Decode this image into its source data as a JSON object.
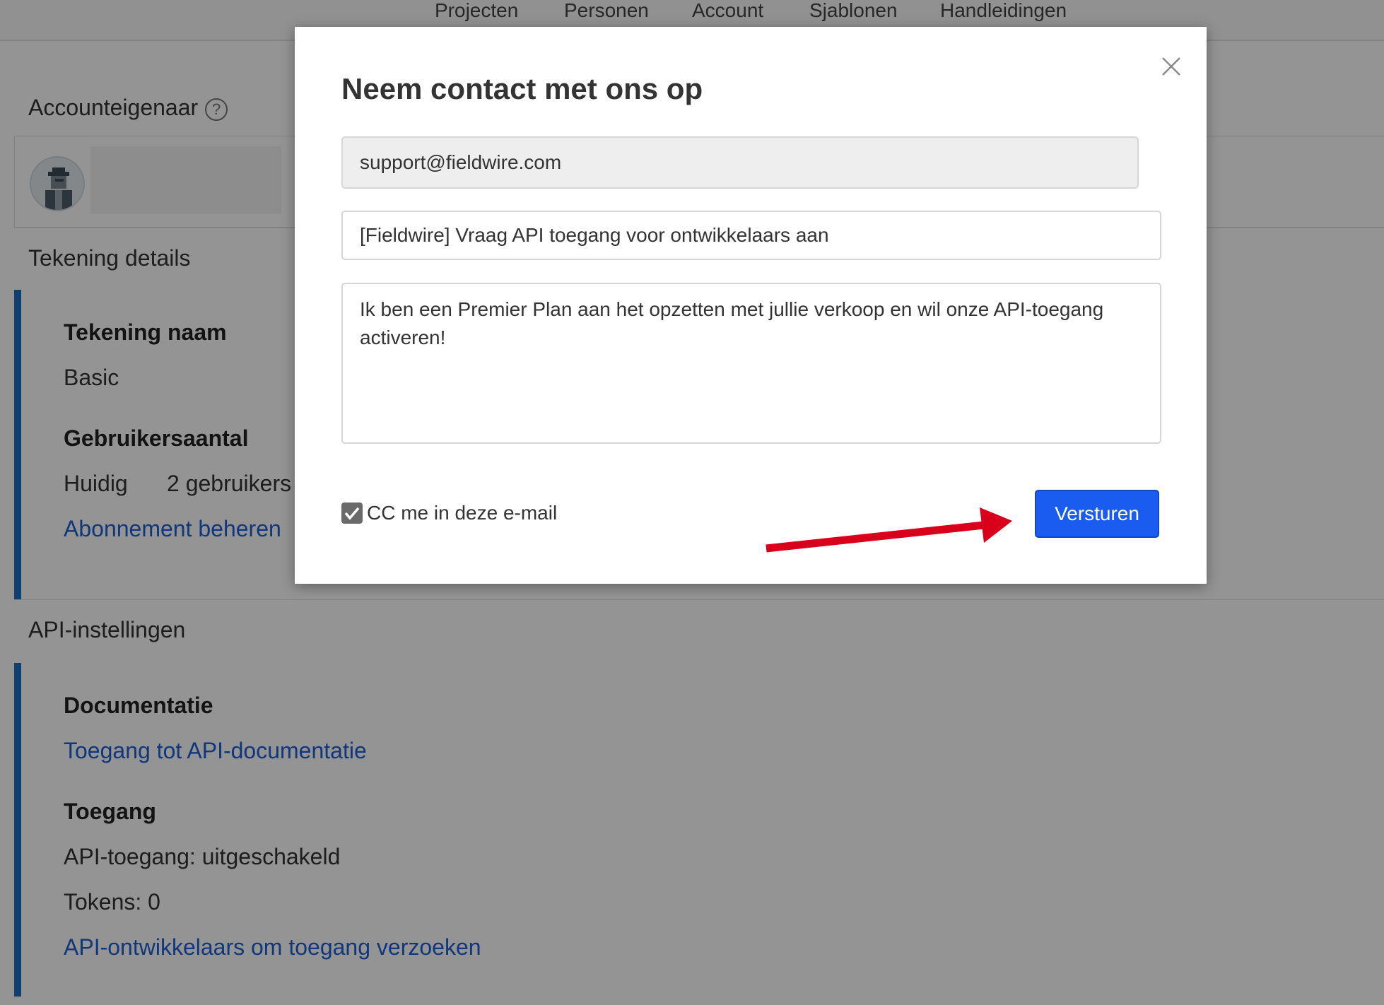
{
  "topnav": {
    "items": [
      "Projecten",
      "Personen",
      "Account",
      "Sjablonen",
      "Handleidingen"
    ]
  },
  "owner": {
    "heading": "Accounteigenaar",
    "help_glyph": "?"
  },
  "plan": {
    "heading": "Tekening details",
    "name_label": "Tekening naam",
    "name_value": "Basic",
    "users_label": "Gebruikersaantal",
    "current_label": "Huidig",
    "current_value": "2 gebruikers",
    "manage_link": "Abonnement beheren"
  },
  "api": {
    "heading": "API-instellingen",
    "docs_label": "Documentatie",
    "docs_link": "Toegang tot API-documentatie",
    "access_label": "Toegang",
    "access_status": "API-toegang: uitgeschakeld",
    "tokens": "Tokens: 0",
    "request_link": "API-ontwikkelaars om toegang verzoeken"
  },
  "modal": {
    "title": "Neem contact met ons op",
    "to": "support@fieldwire.com",
    "subject": "[Fieldwire] Vraag API toegang voor ontwikkelaars aan",
    "body": "Ik ben een Premier Plan aan het opzetten met jullie verkoop en wil onze API-toegang activeren!",
    "cc_label": "CC me in deze e-mail",
    "cc_checked": true,
    "send_label": "Versturen"
  },
  "colors": {
    "accent": "#1a5cf0",
    "link": "#1c5ed6",
    "card_border": "#1c6fc2",
    "annotation_arrow": "#d9001b"
  },
  "icons": {
    "close": "close-icon",
    "help": "question-circle-icon",
    "avatar": "user-avatar-icon",
    "checkbox": "checkbox-checked-icon"
  }
}
